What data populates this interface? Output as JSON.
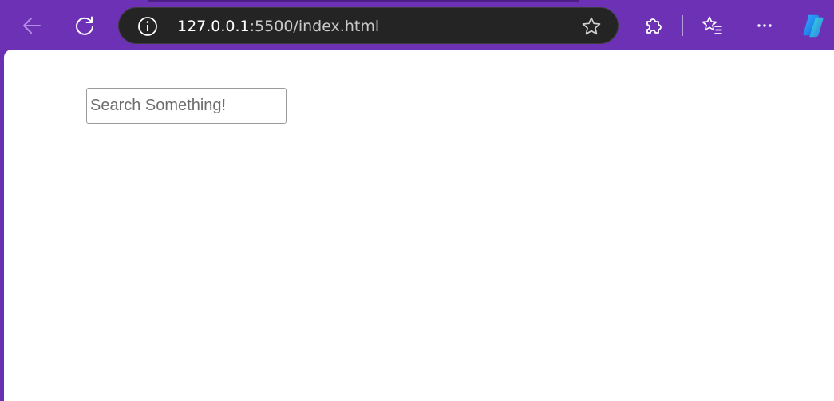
{
  "browser": {
    "url_host": "127.0.0.1",
    "url_rest": ":5500/index.html",
    "icons": {
      "back": "arrow-left-icon",
      "refresh": "refresh-icon",
      "info": "info-icon",
      "favorite": "star-icon",
      "extensions": "puzzle-icon",
      "favorites": "star-list-icon",
      "more": "more-horizontal-icon",
      "copilot": "copilot-icon"
    },
    "colors": {
      "frame": "#6d31b6",
      "addressbar": "#242424"
    }
  },
  "page": {
    "search": {
      "placeholder": "Search Something!",
      "value": ""
    }
  }
}
